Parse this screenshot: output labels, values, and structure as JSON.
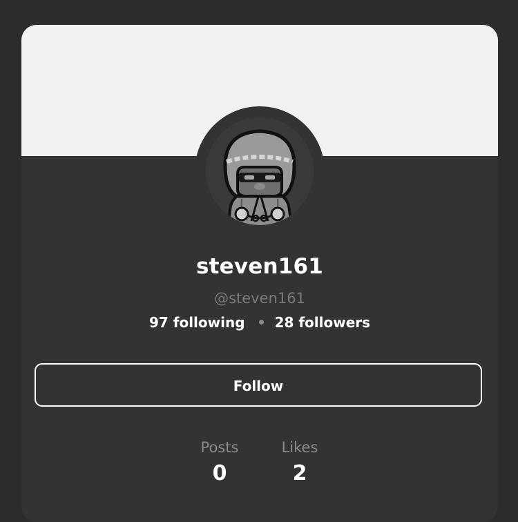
{
  "profile": {
    "display_name": "steven161",
    "handle": "@steven161",
    "following_text": "97 following",
    "followers_text": "28 followers"
  },
  "actions": {
    "follow_label": "Follow"
  },
  "metrics": [
    {
      "label": "Posts",
      "value": "0"
    },
    {
      "label": "Likes",
      "value": "2"
    }
  ],
  "icons": {
    "avatar": "hooded-ninja-character-avatar",
    "separator": "dot-separator"
  },
  "colors": {
    "page_background": "#2c2c2c",
    "card_background": "#333333",
    "banner_background": "#f2f2f2",
    "text_primary": "#ffffff",
    "text_muted": "#7a7a7a"
  }
}
